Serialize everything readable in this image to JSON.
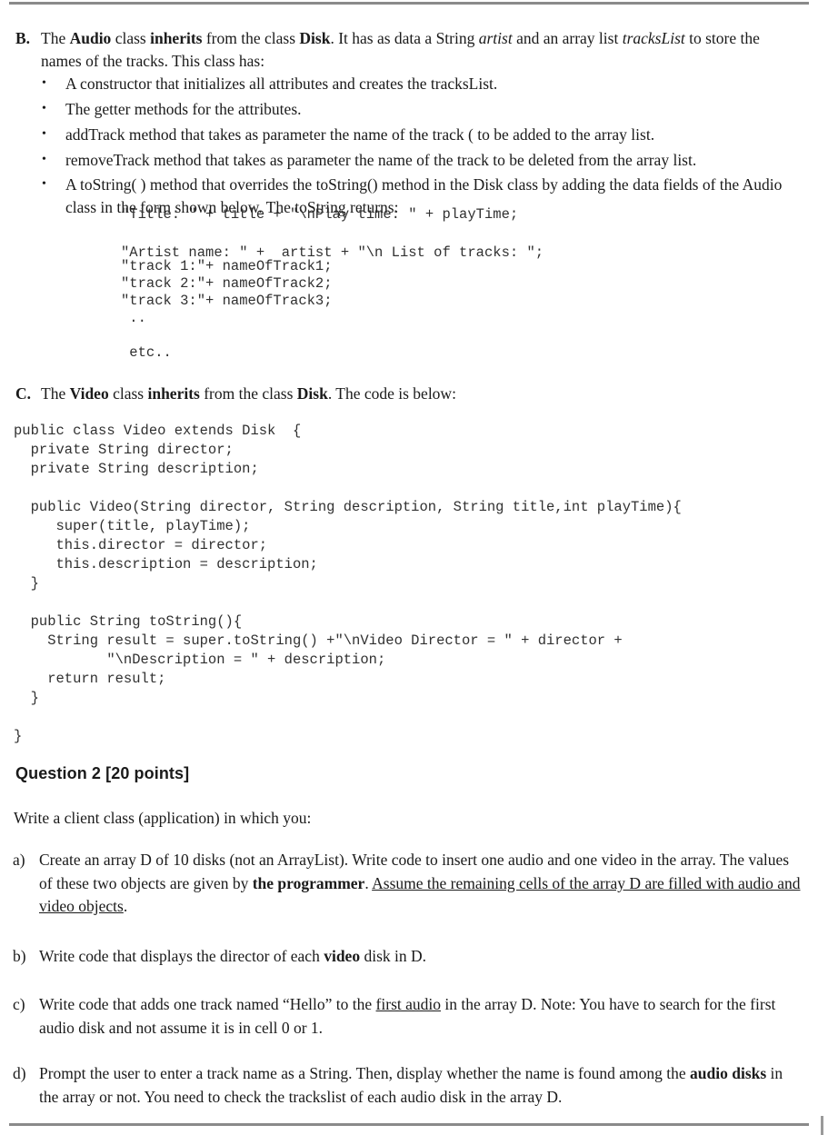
{
  "rules": {
    "top": "horizontal-rule",
    "bottom": "horizontal-rule"
  },
  "section_b": {
    "marker": "B.",
    "text_parts": [
      {
        "t": "The ",
        "s": "n"
      },
      {
        "t": "Audio",
        "s": "b"
      },
      {
        "t": " class ",
        "s": "n"
      },
      {
        "t": "inherits",
        "s": "b"
      },
      {
        "t": " from the class ",
        "s": "n"
      },
      {
        "t": "Disk",
        "s": "b"
      },
      {
        "t": ". It has as data a String ",
        "s": "n"
      },
      {
        "t": "artist",
        "s": "i"
      },
      {
        "t": " and an array list ",
        "s": "n"
      },
      {
        "t": "tracksList",
        "s": "i"
      },
      {
        "t": " to store the names of the tracks. This class has:",
        "s": "n"
      }
    ],
    "bullet_marker": "•",
    "bullets": [
      "A constructor that initializes all attributes and creates the tracksList.",
      "The getter methods for the attributes.",
      "addTrack method that takes as parameter the name of the track ( to be added to the array list.",
      "removeTrack method that takes as parameter the name of the track to be deleted from the array list.",
      "A toString( ) method that overrides the toString() method in the Disk class by adding the data fields of the Audio class in the form shown below. The toString returns:"
    ],
    "code_block_1": "\"Title: \" + title + \"\\nPlay time: \" + playTime;\n\n\"Artist name: \" +  artist + \"\\n List of tracks: \";",
    "code_block_2": "\"track 1:\"+ nameOfTrack1;\n\"track 2:\"+ nameOfTrack2;\n\"track 3:\"+ nameOfTrack3;\n ..\n\n etc.."
  },
  "section_c": {
    "marker": "C.",
    "text_parts": [
      {
        "t": "The ",
        "s": "n"
      },
      {
        "t": "Video",
        "s": "b"
      },
      {
        "t": " class ",
        "s": "n"
      },
      {
        "t": "inherits",
        "s": "b"
      },
      {
        "t": " from the class ",
        "s": "n"
      },
      {
        "t": "Disk",
        "s": "b"
      },
      {
        "t": ". The code is below:",
        "s": "n"
      }
    ],
    "code": "public class Video extends Disk  {\n  private String director;\n  private String description;\n\n  public Video(String director, String description, String title,int playTime){\n     super(title, playTime);\n     this.director = director;\n     this.description = description;\n  }\n\n  public String toString(){\n    String result = super.toString() +\"\\nVideo Director = \" + director +\n           \"\\nDescription = \" + description;\n    return result;\n  }\n\n}"
  },
  "question2": {
    "heading": "Question 2 [20 points]",
    "intro": "Write a client class (application) in which you:",
    "items": [
      {
        "marker": "a)",
        "parts": [
          {
            "t": "Create an array D of 10 disks (not an ArrayList). Write code to insert one audio and one video in the array. The values of these two objects are given by ",
            "s": "n"
          },
          {
            "t": "the programmer",
            "s": "b"
          },
          {
            "t": ". ",
            "s": "n"
          },
          {
            "t": "Assume the remaining cells of the array D are filled with audio and video objects",
            "s": "u"
          },
          {
            "t": ".",
            "s": "n"
          }
        ]
      },
      {
        "marker": "b)",
        "parts": [
          {
            "t": "Write code that displays the director of each ",
            "s": "n"
          },
          {
            "t": "video",
            "s": "b"
          },
          {
            "t": " disk in D.",
            "s": "n"
          }
        ]
      },
      {
        "marker": "c)",
        "parts": [
          {
            "t": "Write code that adds one track named “Hello” to the ",
            "s": "n"
          },
          {
            "t": "first audio",
            "s": "u"
          },
          {
            "t": " in the array D. Note: You have to search for the first audio disk and not assume it is in cell 0 or 1.",
            "s": "n"
          }
        ]
      },
      {
        "marker": "d)",
        "parts": [
          {
            "t": "Prompt the user to enter a track name as a String. Then, display whether the name is found among the ",
            "s": "n"
          },
          {
            "t": "audio disks",
            "s": "b"
          },
          {
            "t": " in the array or not. You need to check the trackslist of each audio disk in the array D.",
            "s": "n"
          }
        ]
      }
    ]
  }
}
